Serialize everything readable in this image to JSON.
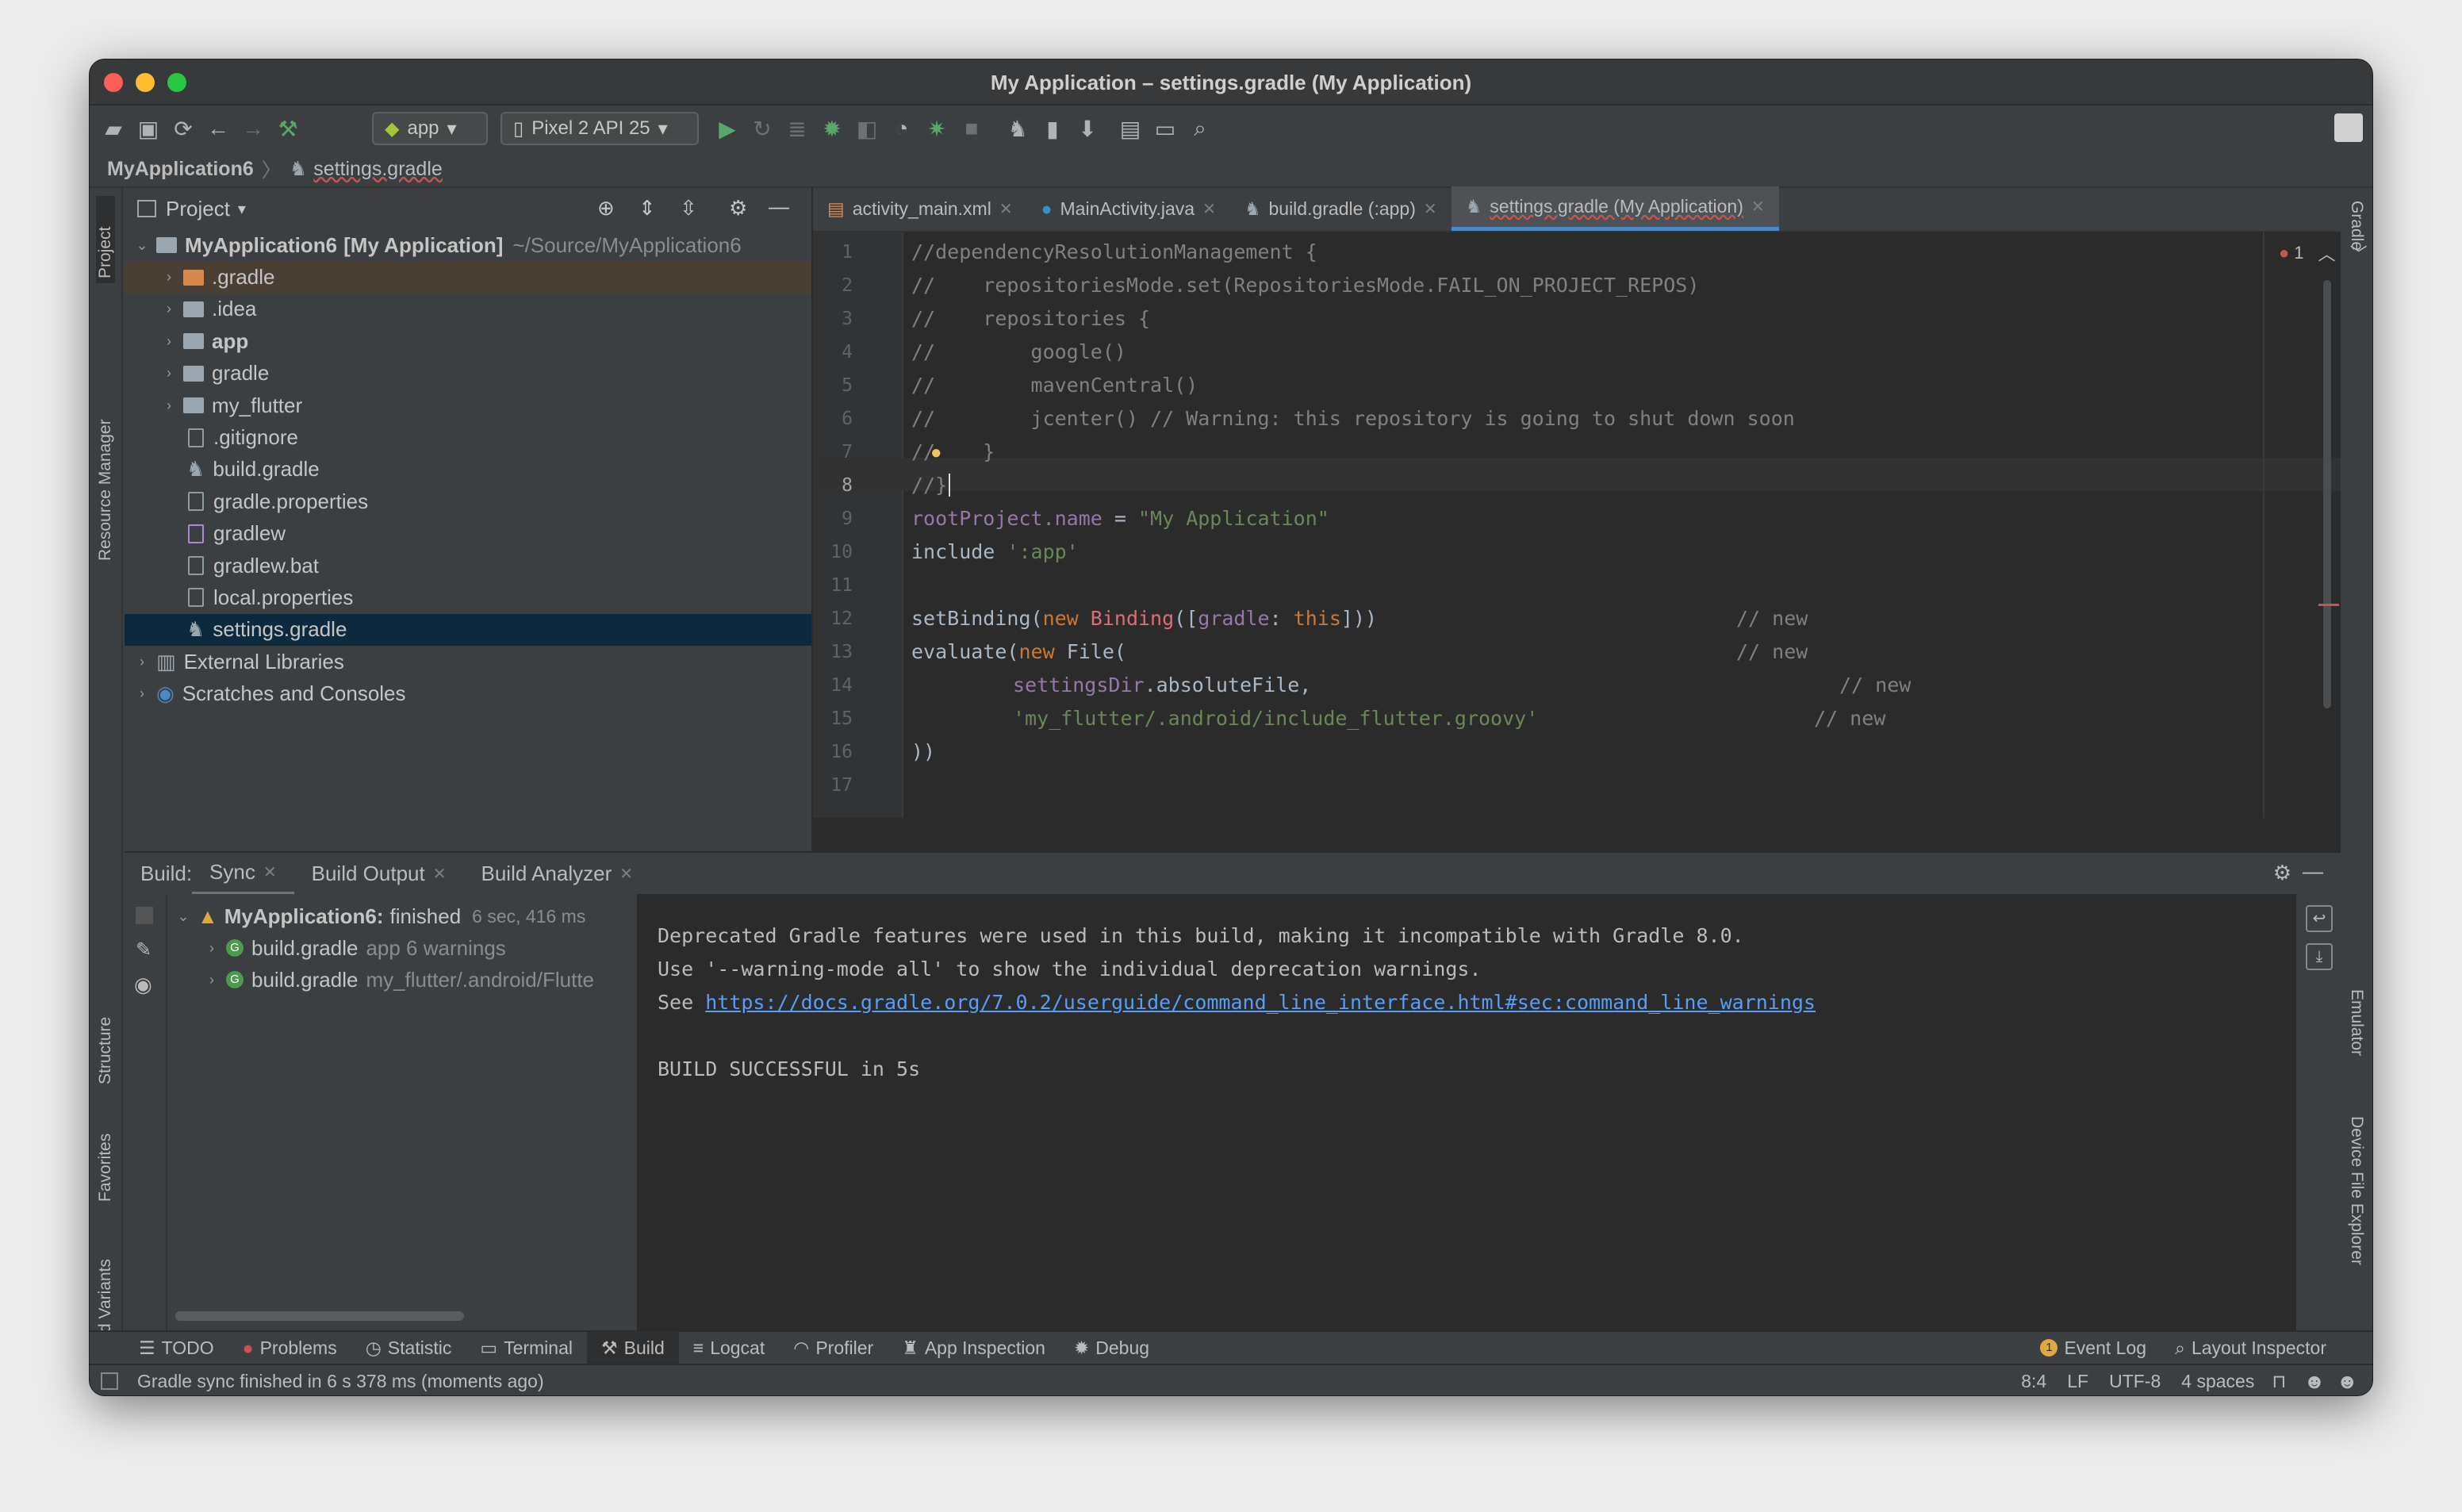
{
  "window": {
    "title": "My Application – settings.gradle (My Application)"
  },
  "toolbar": {
    "run_config": "app",
    "device": "Pixel 2 API 25"
  },
  "breadcrumb": {
    "project": "MyApplication6",
    "file": "settings.gradle"
  },
  "left_tools": {
    "project": "Project",
    "resource_manager": "Resource Manager",
    "structure": "Structure",
    "favorites": "Favorites",
    "build_variants": "Build Variants"
  },
  "right_tools": {
    "gradle": "Gradle",
    "emulator": "Emulator",
    "device_file_explorer": "Device File Explorer"
  },
  "project_panel": {
    "title": "Project",
    "root": {
      "name": "MyApplication6",
      "module": "[My Application]",
      "path": "~/Source/MyApplication6"
    },
    "items": [
      {
        "name": ".gradle",
        "type": "folder-orange"
      },
      {
        "name": ".idea",
        "type": "folder"
      },
      {
        "name": "app",
        "type": "folder-module"
      },
      {
        "name": "gradle",
        "type": "folder"
      },
      {
        "name": "my_flutter",
        "type": "folder"
      },
      {
        "name": ".gitignore",
        "type": "file"
      },
      {
        "name": "build.gradle",
        "type": "gradle"
      },
      {
        "name": "gradle.properties",
        "type": "file"
      },
      {
        "name": "gradlew",
        "type": "file"
      },
      {
        "name": "gradlew.bat",
        "type": "file"
      },
      {
        "name": "local.properties",
        "type": "file"
      },
      {
        "name": "settings.gradle",
        "type": "gradle"
      }
    ],
    "external_libraries": "External Libraries",
    "scratches": "Scratches and Consoles"
  },
  "editor_tabs": [
    {
      "label": "activity_main.xml"
    },
    {
      "label": "MainActivity.java"
    },
    {
      "label": "build.gradle (:app)"
    },
    {
      "label": "settings.gradle (My Application)"
    }
  ],
  "editor": {
    "error_count": "1",
    "line_numbers": [
      "1",
      "2",
      "3",
      "4",
      "5",
      "6",
      "7",
      "8",
      "9",
      "10",
      "11",
      "12",
      "13",
      "14",
      "15",
      "16",
      "17"
    ],
    "lines": {
      "l1": "//dependencyResolutionManagement {",
      "l2": "//    repositoriesMode.set(RepositoriesMode.FAIL_ON_PROJECT_REPOS)",
      "l3": "//    repositories {",
      "l4": "//        google()",
      "l5": "//        mavenCentral()",
      "l6": "//        jcenter() // Warning: this repository is going to shut down soon",
      "l7": "//    }",
      "l8": "//}",
      "l9_a": "rootProject.name",
      "l9_b": " = ",
      "l9_c": "\"My Application\"",
      "l10_a": "include ",
      "l10_b": "':app'",
      "l12_a": "setBinding(",
      "l12_b": "new ",
      "l12_c": "Binding",
      "l12_d": "([",
      "l12_e": "gradle",
      "l12_f": ": ",
      "l12_g": "this",
      "l12_h": "]))",
      "l12_cm": "// new",
      "l13_a": "evaluate(",
      "l13_b": "new ",
      "l13_c": "File(",
      "l13_cm": "// new",
      "l14_a": "settingsDir",
      "l14_b": ".absoluteFile,",
      "l14_cm": "// new",
      "l15_a": "'my_flutter/.android/include_flutter.groovy'",
      "l15_cm": "// new",
      "l16": "))"
    }
  },
  "build_panel": {
    "label": "Build:",
    "tabs": [
      {
        "label": "Sync"
      },
      {
        "label": "Build Output"
      },
      {
        "label": "Build Analyzer"
      }
    ],
    "tree": {
      "root_name": "MyApplication6:",
      "root_status": "finished",
      "root_time": "6 sec, 416 ms",
      "child1_name": "build.gradle",
      "child1_detail": "app 6 warnings",
      "child2_name": "build.gradle",
      "child2_detail": "my_flutter/.android/Flutte"
    },
    "output": {
      "line1": "Deprecated Gradle features were used in this build, making it incompatible with Gradle 8.0.",
      "line2": "Use '--warning-mode all' to show the individual deprecation warnings.",
      "line3_prefix": "See ",
      "line3_link": "https://docs.gradle.org/7.0.2/userguide/command_line_interface.html#sec:command_line_warnings",
      "line5": "BUILD SUCCESSFUL in 5s"
    }
  },
  "bottom_tools": [
    {
      "label": "TODO"
    },
    {
      "label": "Problems"
    },
    {
      "label": "Statistic"
    },
    {
      "label": "Terminal"
    },
    {
      "label": "Build"
    },
    {
      "label": "Logcat"
    },
    {
      "label": "Profiler"
    },
    {
      "label": "App Inspection"
    },
    {
      "label": "Debug"
    }
  ],
  "bottom_right_tools": {
    "event_log": "Event Log",
    "event_count": "1",
    "layout_inspector": "Layout Inspector"
  },
  "status": {
    "message": "Gradle sync finished in 6 s 378 ms (moments ago)",
    "position": "8:4",
    "line_sep": "LF",
    "encoding": "UTF-8",
    "indent": "4 spaces"
  },
  "colors": {
    "accent": "#4a88c7",
    "selection": "#0d293e",
    "error": "#e06c75"
  }
}
